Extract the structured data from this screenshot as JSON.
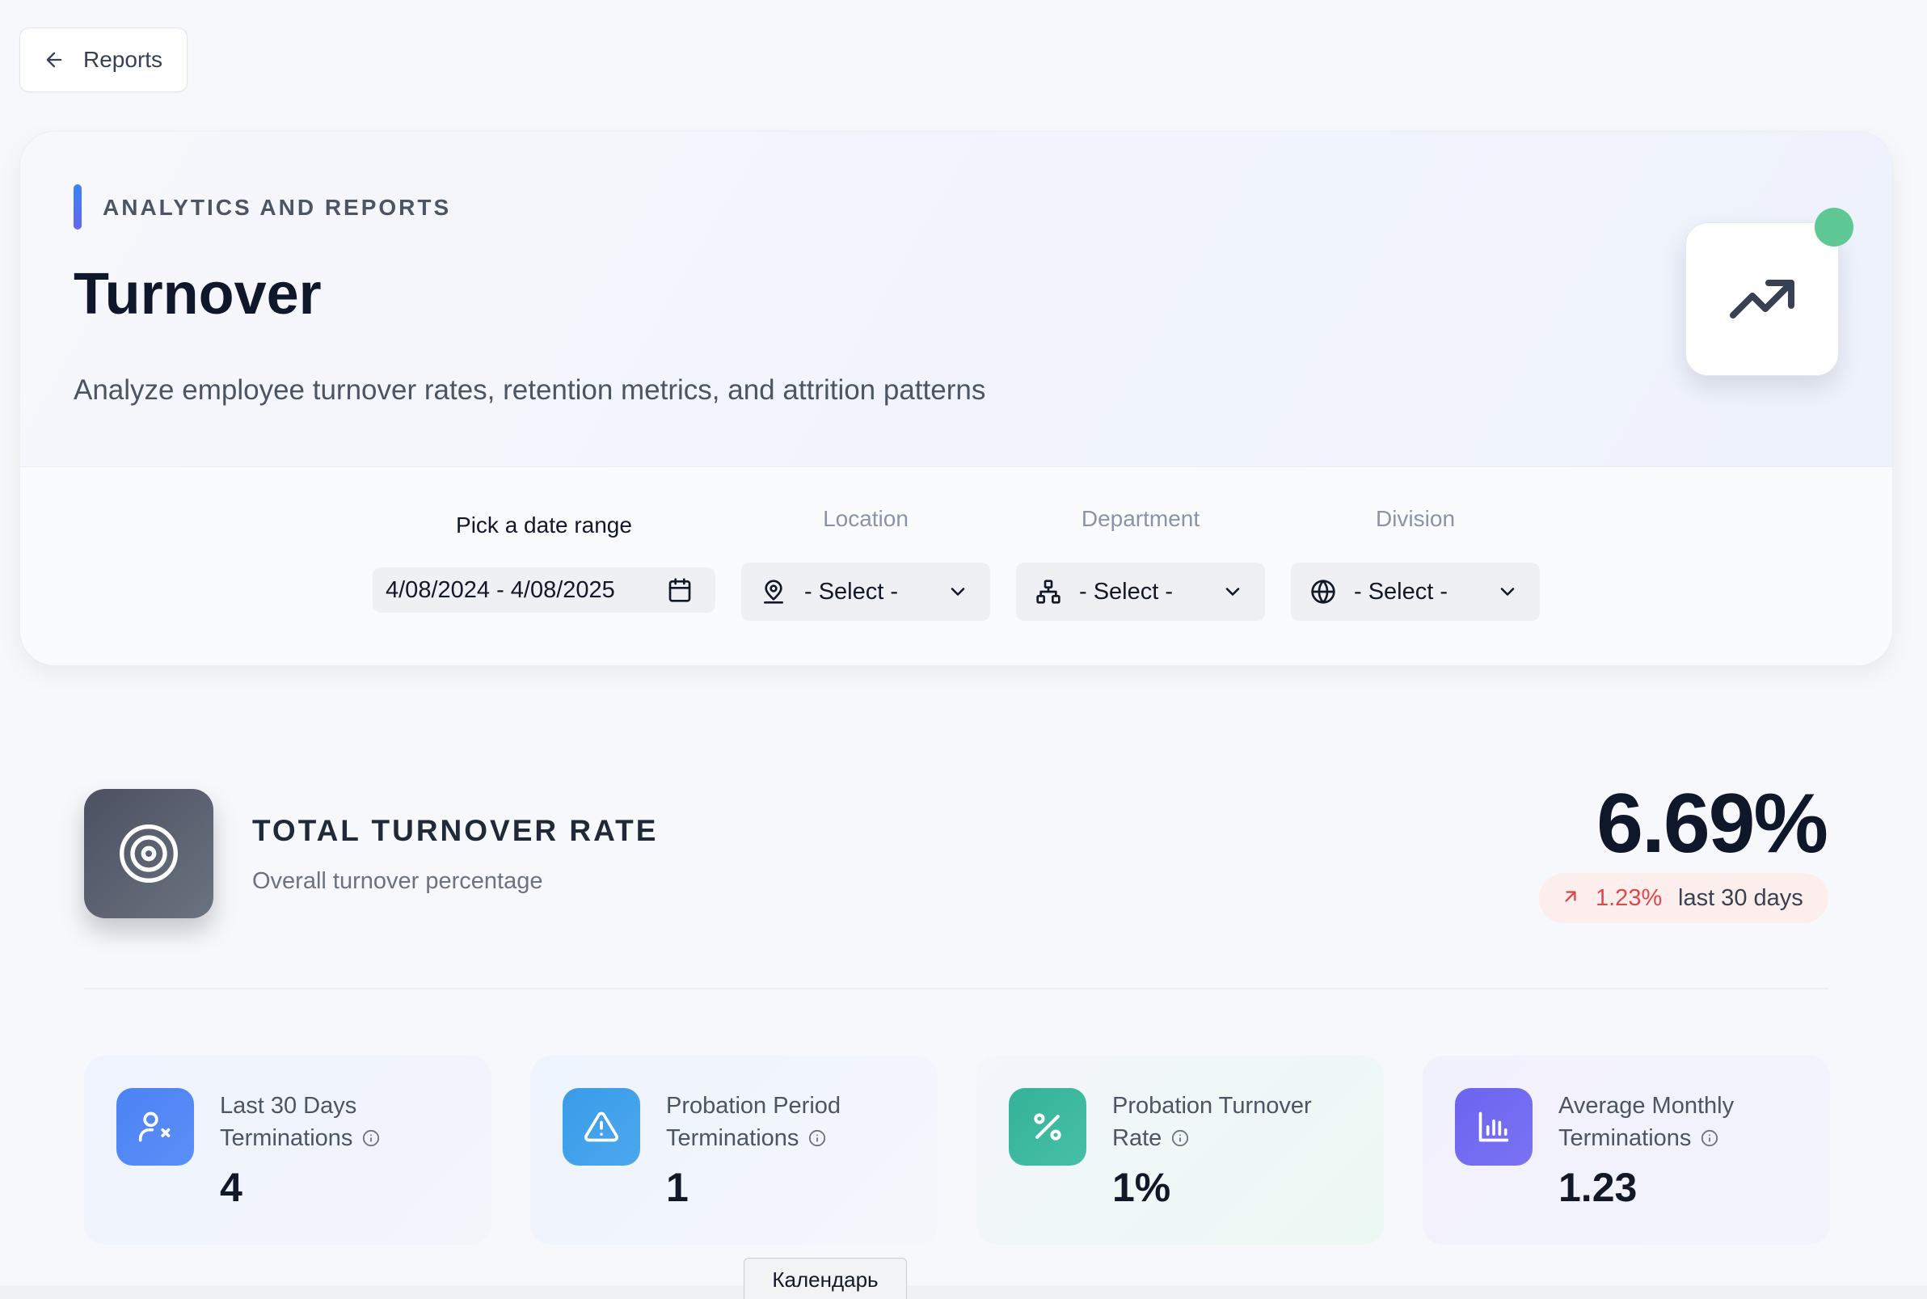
{
  "back_button": {
    "label": "Reports"
  },
  "header": {
    "eyebrow": "ANALYTICS AND REPORTS",
    "title": "Turnover",
    "subtitle": "Analyze employee turnover rates, retention metrics, and attrition patterns",
    "icon": "trending-up-icon",
    "status_color": "#5ec994"
  },
  "filters": {
    "date_range": {
      "label": "Pick a date range",
      "value": "4/08/2024 - 4/08/2025",
      "icon": "calendar-icon"
    },
    "location": {
      "label": "Location",
      "value": "- Select -",
      "icon": "map-pin-user-icon"
    },
    "department": {
      "label": "Department",
      "value": "- Select -",
      "icon": "org-chart-icon"
    },
    "division": {
      "label": "Division",
      "value": "- Select -",
      "icon": "globe-icon"
    }
  },
  "kpi": {
    "title": "TOTAL TURNOVER RATE",
    "subtitle": "Overall turnover percentage",
    "value": "6.69%",
    "trend_value": "1.23%",
    "trend_period": "last 30 days",
    "trend_color": "#e0474c",
    "icon": "target-icon"
  },
  "cards": [
    {
      "line1": "Last 30 Days",
      "line2": "Terminations",
      "value": "4",
      "icon": "user-x-icon",
      "color": "#4c82f5"
    },
    {
      "line1": "Probation Period",
      "line2": "Terminations",
      "value": "1",
      "icon": "warning-icon",
      "color": "#3b9be8"
    },
    {
      "line1": "Probation Turnover",
      "line2": "Rate",
      "value": "1%",
      "icon": "percent-icon",
      "color": "#36b29a"
    },
    {
      "line1": "Average Monthly",
      "line2": "Terminations",
      "value": "1.23",
      "icon": "bar-chart-icon",
      "color": "#6c63f0"
    }
  ],
  "tooltip": {
    "text": "Календарь"
  }
}
